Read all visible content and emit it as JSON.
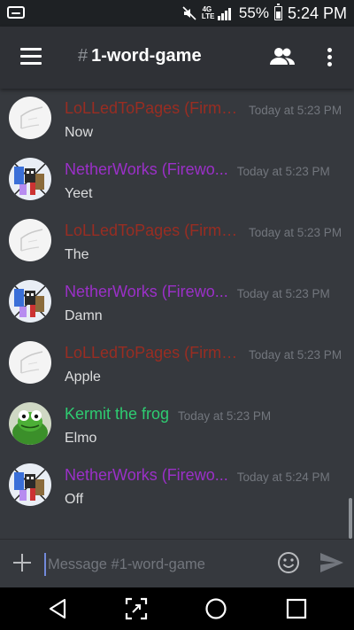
{
  "status_bar": {
    "time": "5:24 PM",
    "battery": "55%",
    "network": "4G LTE",
    "icons": [
      "notification-icon",
      "mute-icon",
      "lte-icon",
      "signal-icon",
      "battery-icon"
    ]
  },
  "app_bar": {
    "hash": "#",
    "channel_name": "1-word-game",
    "icons": [
      "hamburger-menu-icon",
      "members-icon",
      "overflow-menu-icon"
    ]
  },
  "messages": [
    {
      "author": "LoLLedToPages (Firme...",
      "time": "Today at 5:23 PM",
      "content": "Now",
      "author_color": "#992d22",
      "avatar": "drawing"
    },
    {
      "author": "NetherWorks (Firewo...",
      "time": "Today at 5:23 PM",
      "content": "Yeet",
      "author_color": "#9b30c8",
      "avatar": "character"
    },
    {
      "author": "LoLLedToPages (Firme...",
      "time": "Today at 5:23 PM",
      "content": "The",
      "author_color": "#992d22",
      "avatar": "drawing"
    },
    {
      "author": "NetherWorks (Firewo...",
      "time": "Today at 5:23 PM",
      "content": "Damn",
      "author_color": "#9b30c8",
      "avatar": "character"
    },
    {
      "author": "LoLLedToPages (Firme...",
      "time": "Today at 5:23 PM",
      "content": "Apple",
      "author_color": "#992d22",
      "avatar": "drawing"
    },
    {
      "author": "Kermit the frog",
      "time": "Today at 5:23 PM",
      "content": "Elmo",
      "author_color": "#2ecc71",
      "avatar": "frog"
    },
    {
      "author": "NetherWorks (Firewo...",
      "time": "Today at 5:24 PM",
      "content": "Off",
      "author_color": "#9b30c8",
      "avatar": "character"
    }
  ],
  "composer": {
    "placeholder": "Message #1-word-game",
    "icons": [
      "add-icon",
      "emoji-icon",
      "send-icon"
    ]
  },
  "nav_bar": {
    "icons": [
      "back-icon",
      "screenshot-icon",
      "home-icon",
      "recents-icon"
    ]
  },
  "colors": {
    "background": "#36393e",
    "header": "#2f3136",
    "accent": "#7289da"
  }
}
